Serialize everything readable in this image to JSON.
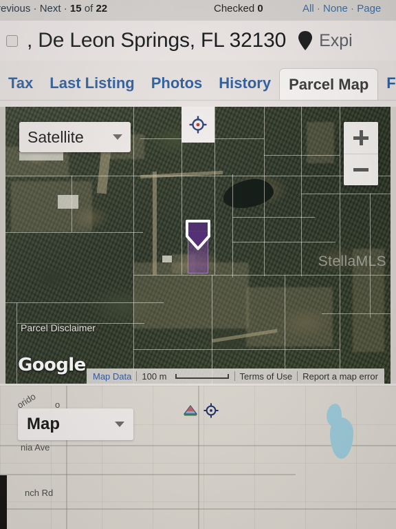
{
  "topbar": {
    "previous_label": "Previous",
    "sep": "·",
    "next_label": "Next",
    "position_current": "15",
    "position_of": "of",
    "position_total": "22",
    "checked_label": "Checked",
    "checked_count": "0",
    "select_all": "All",
    "select_none": "None",
    "select_page": "Page"
  },
  "listing": {
    "address": ", De Leon Springs, FL 32130",
    "status": "Expi",
    "status_icon": "map-pin-icon",
    "checkbox_checked": false
  },
  "tabs": [
    {
      "label": "Tax",
      "active": false
    },
    {
      "label": "Last Listing",
      "active": false
    },
    {
      "label": "Photos",
      "active": false
    },
    {
      "label": "History",
      "active": false
    },
    {
      "label": "Parcel Map",
      "active": true
    },
    {
      "label": "F",
      "active": false
    }
  ],
  "map": {
    "type_selector": {
      "value": "Satellite",
      "caret_icon": "chevron-down-icon"
    },
    "zoom_in_icon": "plus-icon",
    "zoom_out_icon": "minus-icon",
    "crosshair_icon": "crosshair-icon",
    "parcel_marker_icon": "parcel-pin-icon",
    "disclaimer_link": "Parcel Disclaimer",
    "watermark": "StellaMLS",
    "provider_logo": "Google",
    "attribution": {
      "map_data": "Map Data",
      "scale_label": "100 m",
      "terms": "Terms of Use",
      "report": "Report a map error"
    }
  },
  "lower_map": {
    "type_selector": {
      "value": "Map",
      "caret_icon": "chevron-down-icon"
    },
    "layers_icon": "map-layers-icon",
    "crosshair_icon": "crosshair-icon",
    "labels": [
      {
        "text": "orido"
      },
      {
        "text": "o"
      },
      {
        "text": "nia Ave"
      },
      {
        "text": "nch Rd"
      }
    ]
  },
  "colors": {
    "tab_link": "#2f5f9e",
    "tab_active_text": "#3b3b3b",
    "header_link": "#3a6ea5",
    "parcel_highlight": "#783ca0",
    "water": "#9fcede",
    "map_chrome": "#f0ebe9"
  }
}
